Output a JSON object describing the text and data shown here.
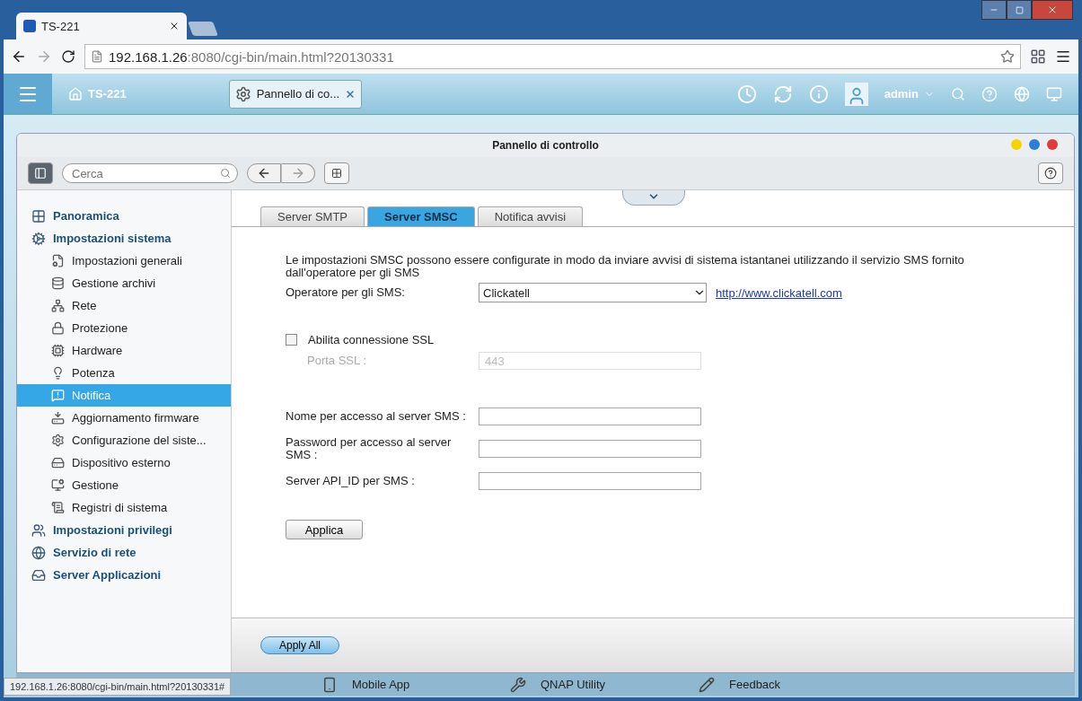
{
  "browser": {
    "tabs": [
      {
        "title": "TS-221",
        "selected": true
      }
    ],
    "address": {
      "host": "192.168.1.26",
      "rest": ":8080/cgi-bin/main.html?20130331"
    }
  },
  "topbar": {
    "home": "TS-221",
    "app_tab": "Pannello di co...",
    "user": "admin"
  },
  "window": {
    "title": "Pannello di controllo",
    "search": {
      "placeholder": "Cerca"
    }
  },
  "sidebar": {
    "items": [
      {
        "label": "Panoramica",
        "selected": false
      },
      {
        "label": "Impostazioni sistema",
        "selected": false,
        "children": [
          {
            "label": "Impostazioni generali",
            "selected": false
          },
          {
            "label": "Gestione archivi",
            "selected": false
          },
          {
            "label": "Rete",
            "selected": false
          },
          {
            "label": "Protezione",
            "selected": false
          },
          {
            "label": "Hardware",
            "selected": false
          },
          {
            "label": "Potenza",
            "selected": false
          },
          {
            "label": "Notifica",
            "selected": true
          },
          {
            "label": "Aggiornamento firmware",
            "selected": false
          },
          {
            "label": "Configurazione del siste...",
            "selected": false
          },
          {
            "label": "Dispositivo esterno",
            "selected": false
          },
          {
            "label": "Gestione",
            "selected": false
          },
          {
            "label": "Registri di sistema",
            "selected": false
          }
        ]
      },
      {
        "label": "Impostazioni privilegi",
        "selected": false
      },
      {
        "label": "Servizio di rete",
        "selected": false
      },
      {
        "label": "Server Applicazioni",
        "selected": false
      }
    ]
  },
  "tabs": [
    {
      "label": "Server SMTP",
      "selected": false
    },
    {
      "label": "Server SMSC",
      "selected": true
    },
    {
      "label": "Notifica avvisi",
      "selected": false
    }
  ],
  "form": {
    "intro": "Le impostazioni SMSC possono essere configurate in modo da inviare avvisi di sistema istantanei utilizzando il servizio SMS fornito dall'operatore per gli SMS",
    "fields": [
      {
        "kind": "select",
        "label": "Operatore per gli SMS:",
        "value": "Clickatell",
        "link": "http://www.clickatell.com"
      },
      {
        "kind": "checkbox",
        "label": "Abilita connessione SSL",
        "checked": false
      },
      {
        "kind": "text",
        "label": "Porta SSL :",
        "value": "443",
        "disabled": true
      },
      {
        "kind": "text",
        "label": "Nome per accesso al server SMS :",
        "disabled": false
      },
      {
        "kind": "text",
        "label": "Password per accesso al server SMS :",
        "disabled": false
      },
      {
        "kind": "text",
        "label": "Server API_ID per SMS :",
        "disabled": false
      }
    ],
    "apply": "Applica"
  },
  "footer": {
    "apply_all": "Apply All"
  },
  "desktop_bar": [
    "Mobile App",
    "QNAP Utility",
    "Feedback"
  ],
  "status_url": "192.168.1.26:8080/cgi-bin/main.html?20130331#"
}
